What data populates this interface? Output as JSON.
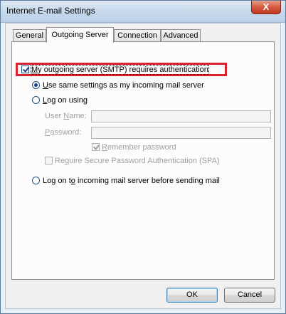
{
  "window": {
    "title": "Internet E-mail Settings",
    "close_glyph": "X"
  },
  "tabs": [
    {
      "label": "General",
      "active": false
    },
    {
      "label": "Outgoing Server",
      "active": true
    },
    {
      "label": "Connection",
      "active": false
    },
    {
      "label": "Advanced",
      "active": false
    }
  ],
  "outgoing": {
    "smtp_auth": {
      "label_pre": "",
      "label_accel": "M",
      "label_post": "y outgoing server (SMTP) requires authentication",
      "checked": true
    },
    "use_same": {
      "label_accel": "U",
      "label_post": "se same settings as my incoming mail server",
      "selected": true
    },
    "log_on_using": {
      "label_accel": "L",
      "label_post": "og on using",
      "selected": false
    },
    "user_name": {
      "label_pre": "User ",
      "label_accel": "N",
      "label_post": "ame:",
      "value": ""
    },
    "password": {
      "label_pre": "",
      "label_accel": "P",
      "label_post": "assword:",
      "value": ""
    },
    "remember_password": {
      "label_pre": "",
      "label_accel": "R",
      "label_post": "emember password",
      "checked": true
    },
    "require_spa": {
      "label_pre": "Re",
      "label_accel": "q",
      "label_post": "uire Secure Password Authentication (SPA)",
      "checked": false
    },
    "log_on_incoming": {
      "label_pre": "Log on t",
      "label_accel": "o",
      "label_post": " incoming mail server before sending mail",
      "selected": false
    }
  },
  "buttons": {
    "ok": "OK",
    "cancel": "Cancel"
  },
  "colors": {
    "highlight_border": "#d9232e",
    "accent": "#1c5180"
  }
}
